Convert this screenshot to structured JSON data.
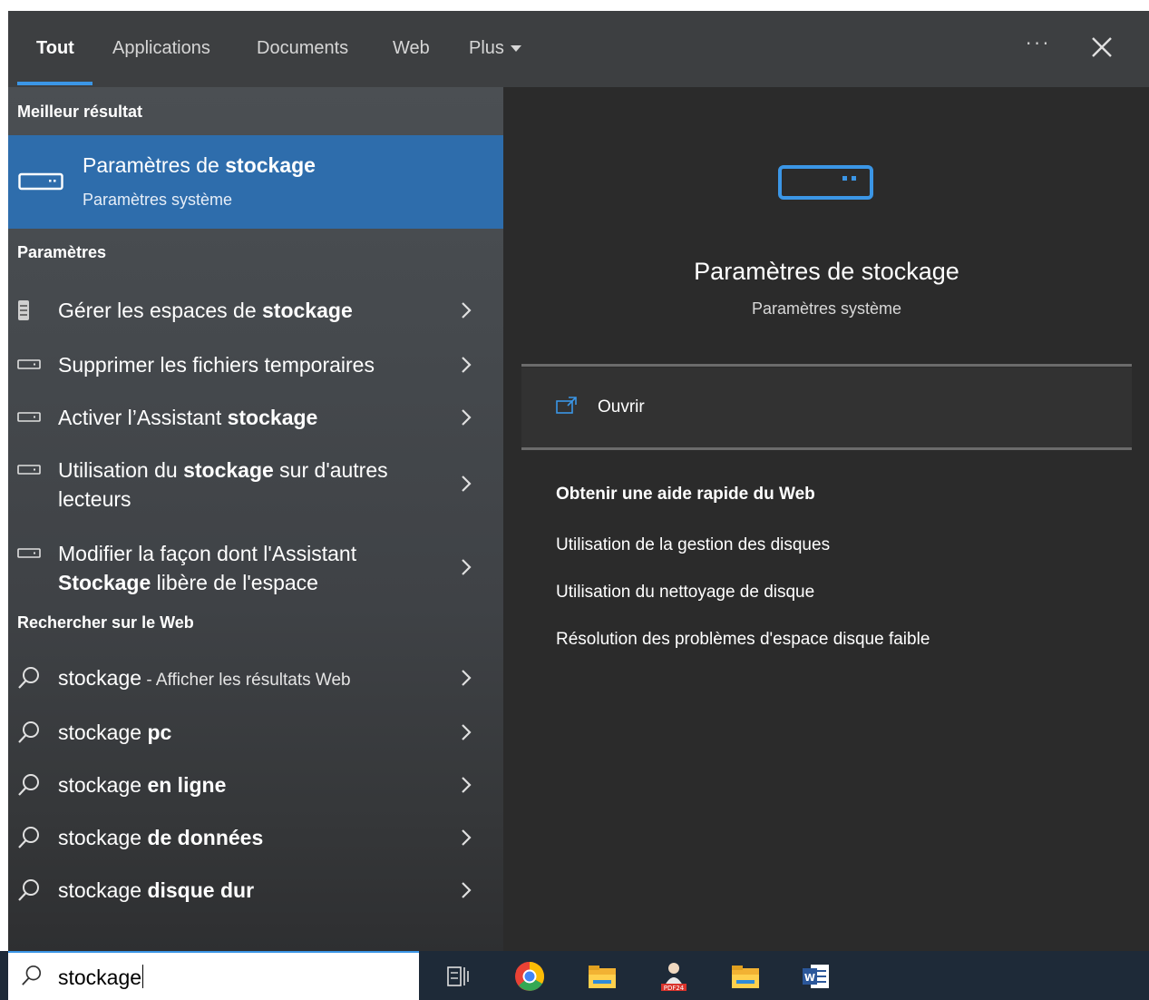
{
  "tabs": {
    "items": [
      {
        "label": "Tout"
      },
      {
        "label": "Applications"
      },
      {
        "label": "Documents"
      },
      {
        "label": "Web"
      },
      {
        "label": "Plus"
      }
    ],
    "more_label": "···"
  },
  "best_match": {
    "header": "Meilleur résultat",
    "title_prefix": "Paramètres de ",
    "title_bold": "stockage",
    "subtitle": "Paramètres système"
  },
  "settings": {
    "header": "Paramètres",
    "items": [
      {
        "pre": "Gérer les espaces de ",
        "bold": "stockage",
        "post": ""
      },
      {
        "pre": "Supprimer les fichiers temporaires",
        "bold": "",
        "post": ""
      },
      {
        "pre": "Activer l’Assistant ",
        "bold": "stockage",
        "post": ""
      },
      {
        "line1_pre": "Utilisation du ",
        "line1_bold": "stockage",
        "line1_post": " sur d'autres",
        "line2": "lecteurs"
      },
      {
        "line1": "Modifier la façon dont l'Assistant",
        "line2_bold": "Stockage",
        "line2_post": " libère de l'espace"
      }
    ]
  },
  "web_search": {
    "header": "Rechercher sur le Web",
    "items": [
      {
        "pre": "stockage",
        "small": " - Afficher les résultats Web",
        "bold": ""
      },
      {
        "pre": "stockage ",
        "bold": "pc"
      },
      {
        "pre": "stockage ",
        "bold": "en ligne"
      },
      {
        "pre": "stockage ",
        "bold": "de données"
      },
      {
        "pre": "stockage ",
        "bold": "disque dur"
      }
    ]
  },
  "preview": {
    "title": "Paramètres de stockage",
    "subtitle": "Paramètres système",
    "open_label": "Ouvrir",
    "web_header": "Obtenir une aide rapide du Web",
    "links": [
      "Utilisation de la gestion des disques",
      "Utilisation du nettoyage de disque",
      "Résolution des problèmes d'espace disque faible"
    ]
  },
  "taskbar": {
    "search_value": "stockage",
    "apps": [
      "task-view-icon",
      "chrome-icon",
      "file-explorer-icon",
      "pdf24-icon",
      "folder-icon",
      "word-icon"
    ]
  },
  "colors": {
    "accent": "#3b96e6",
    "selected": "#2e6dac",
    "taskbar": "#1e2a38"
  }
}
